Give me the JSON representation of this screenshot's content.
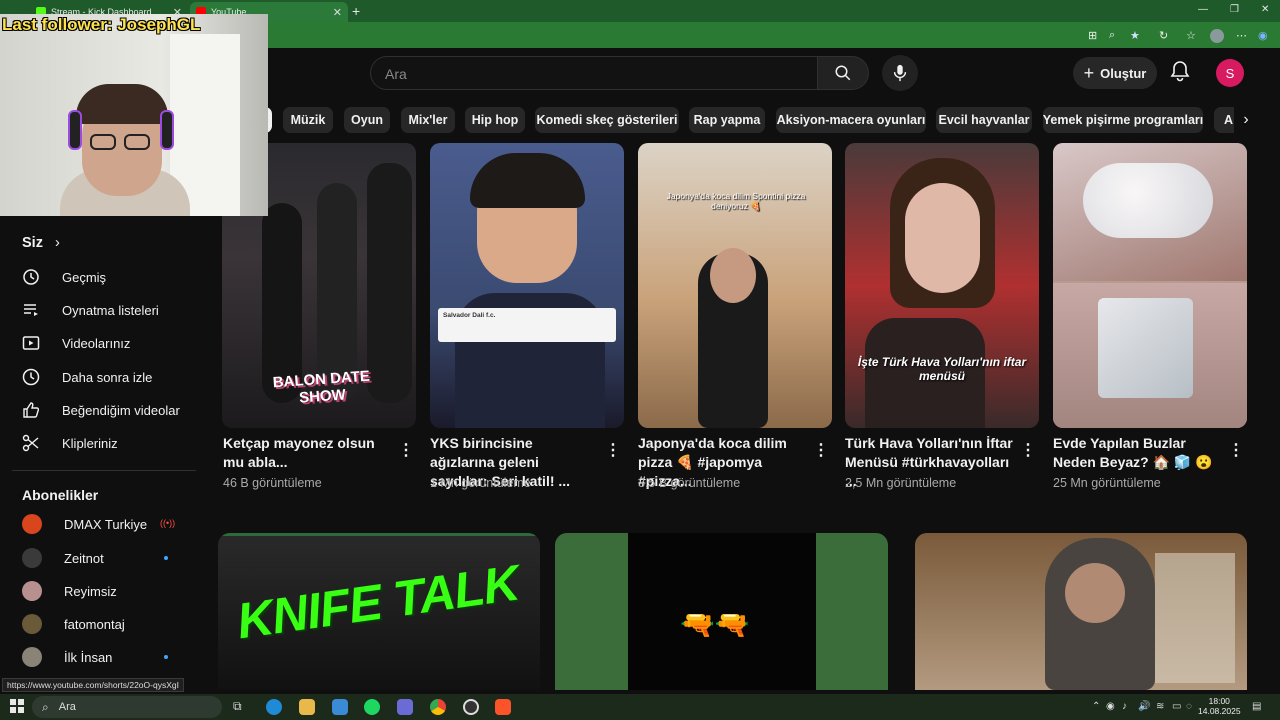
{
  "browser": {
    "tabs": [
      {
        "label": "Stream - Kick Dashboard",
        "icon": "kick-icon"
      },
      {
        "label": "YouTube",
        "icon": "youtube-icon"
      }
    ],
    "new_tab": "+",
    "window_controls": {
      "minimize": "—",
      "maximize": "❐",
      "close": "✕"
    }
  },
  "overlay": {
    "last_follower": "Last follower: JosephGL"
  },
  "header": {
    "search_placeholder": "Ara",
    "create_label": "Oluştur",
    "avatar_letter": "S"
  },
  "chips": [
    "Müzik",
    "Oyun",
    "Mix'ler",
    "Hip hop",
    "Komedi skeç gösterileri",
    "Rap yapma",
    "Aksiyon-macera oyunları",
    "Evcil hayvanlar",
    "Yemek pişirme programları",
    "A"
  ],
  "sidebar": {
    "you_heading": "Siz",
    "you_items": [
      {
        "label": "Geçmiş",
        "icon": "history-icon"
      },
      {
        "label": "Oynatma listeleri",
        "icon": "playlist-icon"
      },
      {
        "label": "Videolarınız",
        "icon": "your-videos-icon"
      },
      {
        "label": "Daha sonra izle",
        "icon": "watch-later-icon"
      },
      {
        "label": "Beğendiğim videolar",
        "icon": "liked-icon"
      },
      {
        "label": "Klipleriniz",
        "icon": "clips-icon"
      }
    ],
    "subs_heading": "Abonelikler",
    "subscriptions": [
      {
        "label": "DMAX Turkiye",
        "status": "live"
      },
      {
        "label": "Zeitnot",
        "status": "new"
      },
      {
        "label": "Reyimsiz",
        "status": ""
      },
      {
        "label": "fatomontaj",
        "status": ""
      },
      {
        "label": "İlk İnsan",
        "status": "new"
      }
    ]
  },
  "shorts": [
    {
      "title": "Ketçap mayonez olsun mu abla...",
      "views": "46 B görüntüleme",
      "overlay": "BALON DATE SHOW"
    },
    {
      "title": "YKS birincisine ağızlarına geleni saydılar: Seri katil! ...",
      "views": "1 Mn görüntüleme",
      "overlay": "Salvador Dali f.c."
    },
    {
      "title": "Japonya'da koca dilim pizza 🍕 #japomya #pizza...",
      "views": "3,5 B görüntüleme",
      "overlay": "Japonya'da koca dilim Spontini pizza deniyoruz 🍕"
    },
    {
      "title": "Türk Hava Yolları'nın İftar Menüsü #türkhavayolları ...",
      "views": "2,5 Mn görüntüleme",
      "overlay": "İşte Türk Hava Yolları'nın iftar menüsü"
    },
    {
      "title": "Evde Yapılan Buzlar Neden Beyaz? 🏠 🧊 😮",
      "views": "25 Mn görüntüleme",
      "overlay": ""
    }
  ],
  "bottom_row": {
    "knife_talk": "KNIFE TALK",
    "guns": "🔫🔫"
  },
  "status_url": "https://www.youtube.com/shorts/22oO-qysXgI",
  "taskbar": {
    "search": "Ara",
    "time": "18:00",
    "date": "14.08.2025"
  }
}
